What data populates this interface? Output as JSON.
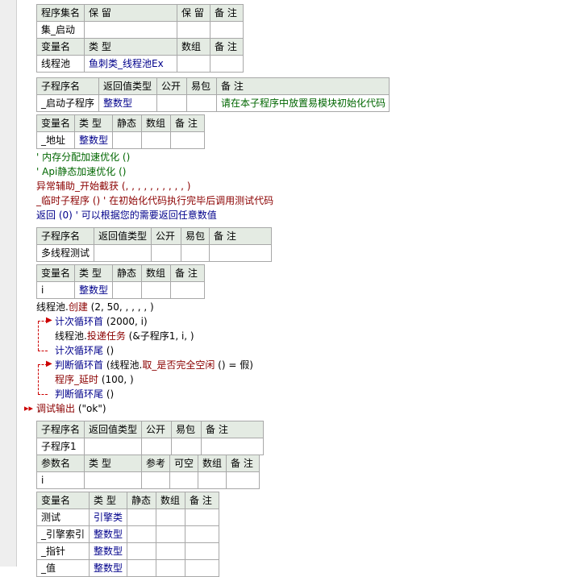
{
  "program_set": {
    "headers": [
      "程序集名",
      "保 留",
      "保 留",
      "备 注"
    ],
    "row": [
      "集_启动",
      "",
      "",
      ""
    ]
  },
  "program_vars": {
    "headers": [
      "变量名",
      "类 型",
      "数组",
      "备 注"
    ],
    "row": [
      "线程池",
      "鱼刺类_线程池Ex",
      "",
      ""
    ]
  },
  "sub1": {
    "headers": [
      "子程序名",
      "返回值类型",
      "公开",
      "易包",
      "备 注"
    ],
    "row": [
      "_启动子程序",
      "整数型",
      "",
      "",
      "请在本子程序中放置易模块初始化代码"
    ]
  },
  "sub1_vars": {
    "headers": [
      "变量名",
      "类 型",
      "静态",
      "数组",
      "备 注"
    ],
    "row": [
      "_地址",
      "整数型",
      "",
      "",
      ""
    ]
  },
  "code1": [
    "' 内存分配加速优化 ()",
    "' Api静态加速优化 ()",
    "异常辅助_开始截获 (, , , , , , , , , , )",
    "_临时子程序 ()  ' 在初始化代码执行完毕后调用测试代码",
    "返回 (0)  ' 可以根据您的需要返回任意数值"
  ],
  "sub2": {
    "headers": [
      "子程序名",
      "返回值类型",
      "公开",
      "易包",
      "备 注"
    ],
    "row": [
      "多线程测试",
      "",
      "",
      "",
      ""
    ]
  },
  "sub2_vars": {
    "headers": [
      "变量名",
      "类 型",
      "静态",
      "数组",
      "备 注"
    ],
    "row": [
      "i",
      "整数型",
      "",
      "",
      ""
    ]
  },
  "code2": {
    "create": {
      "obj": "线程池.",
      "method": "创建",
      "args": " (2, 50, , , , , )"
    },
    "loop_head": {
      "kw": "计次循环首",
      "args": " (2000, i)"
    },
    "post": {
      "obj": "线程池.",
      "method": "投递任务",
      "args": " (&子程序1, i, )"
    },
    "loop_tail": {
      "kw": "计次循环尾",
      "args": " ()"
    },
    "judge_head": {
      "kw": "判断循环首",
      "args": " (线程池.",
      "method": "取_是否完全空闲",
      "rest": " () = 假)"
    },
    "delay": {
      "kw": "程序_延时",
      "args": " (100, )"
    },
    "judge_tail": {
      "kw": "判断循环尾",
      "args": " ()"
    },
    "debug": {
      "kw": "调试输出",
      "args": " (\"ok\")"
    }
  },
  "sub3": {
    "headers": [
      "子程序名",
      "返回值类型",
      "公开",
      "易包",
      "备 注"
    ],
    "row": [
      "子程序1",
      "",
      "",
      "",
      ""
    ]
  },
  "sub3_params": {
    "headers": [
      "参数名",
      "类 型",
      "参考",
      "可空",
      "数组",
      "备 注"
    ],
    "row": [
      "i",
      "",
      "",
      "",
      "",
      ""
    ]
  },
  "sub3_vars": {
    "headers": [
      "变量名",
      "类 型",
      "静态",
      "数组",
      "备 注"
    ],
    "rows": [
      [
        "测试",
        "引擎类",
        "",
        "",
        ""
      ],
      [
        "_引擎索引",
        "整数型",
        "",
        "",
        ""
      ],
      [
        "_指针",
        "整数型",
        "",
        "",
        ""
      ],
      [
        "_值",
        "整数型",
        "",
        "",
        ""
      ]
    ]
  }
}
